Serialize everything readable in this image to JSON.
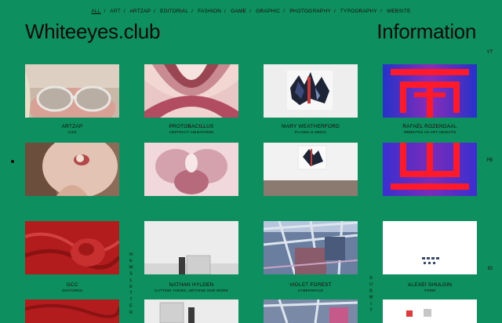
{
  "nav": {
    "items": [
      "ALL",
      "ART",
      "ARTZAP",
      "EDITORIAL",
      "FASHION",
      "GAME",
      "GRAPHIC",
      "PHOTOGRAPHY",
      "TYPOGRAPHY",
      "WEBSITE"
    ],
    "active": "ALL",
    "separator": "/"
  },
  "header": {
    "logo": "Whiteeyes.club",
    "info": "Information"
  },
  "side": {
    "yt": "YT",
    "fb": "FB",
    "ig": "IG"
  },
  "vertical": {
    "newsletter": "NEWSLETTER",
    "submit": "SUBMIT"
  },
  "projects": [
    {
      "title": "ARTZAP",
      "sub": "CIXZ"
    },
    {
      "title": "PROTOBACILLUS",
      "sub": "ABSTRACT ANIMATIONS"
    },
    {
      "title": "MARY WEATHERFORD",
      "sub": "PLASMA & MEDIA"
    },
    {
      "title": "RAFAËL ROZENDAAL",
      "sub": "WEBSITES AS ART OBJECTS"
    },
    {
      "title": "GCC",
      "sub": "GESTURES"
    },
    {
      "title": "NATHAN HYLDEN",
      "sub": "CUTTING THEIRS, NOTHING OUR WORK"
    },
    {
      "title": "VIOLET FOREST",
      "sub": "CYBERSPACE"
    },
    {
      "title": "ALEXEI SHULGIN",
      "sub": "FORM"
    }
  ],
  "colors": {
    "background": "#0e8f5f",
    "text": "#0a0a0a"
  }
}
